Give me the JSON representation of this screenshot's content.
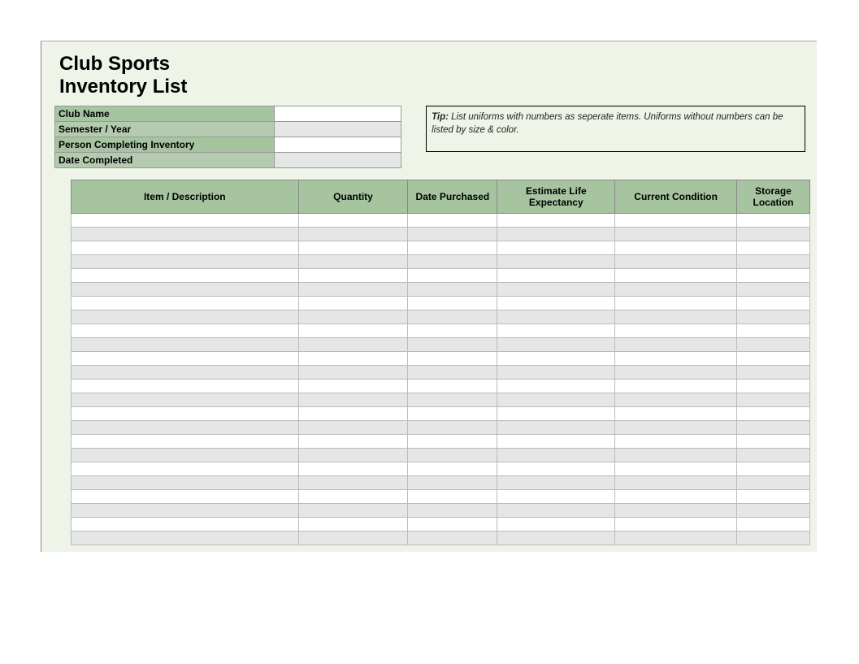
{
  "title_line1": "Club Sports",
  "title_line2": "Inventory List",
  "meta": {
    "fields": [
      {
        "label": "Club Name",
        "value": ""
      },
      {
        "label": "Semester / Year",
        "value": ""
      },
      {
        "label": "Person Completing Inventory",
        "value": ""
      },
      {
        "label": "Date Completed",
        "value": ""
      }
    ]
  },
  "tip": {
    "label": "Tip:",
    "text": " List uniforms with numbers as seperate items. Uniforms without numbers can be listed by size & color."
  },
  "columns": [
    "Item / Description",
    "Quantity",
    "Date Purchased",
    "Estimate Life Expectancy",
    "Current Condition",
    "Storage Location"
  ],
  "row_count": 24
}
